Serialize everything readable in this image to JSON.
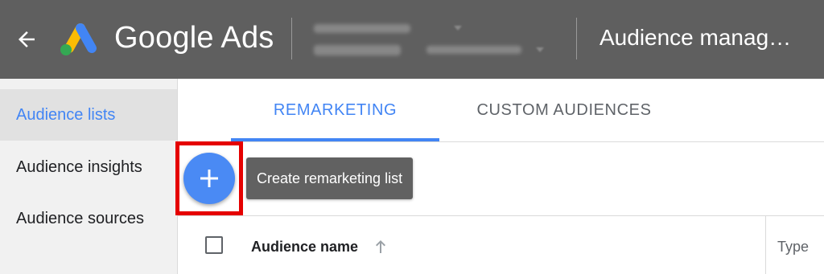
{
  "header": {
    "brand": "Google Ads",
    "page_title": "Audience manag…",
    "background_color": "#5f5f5f",
    "back_icon": "arrow-left-icon",
    "logo_icon": "google-ads-logo-icon"
  },
  "sidebar": {
    "items": [
      {
        "label": "Audience lists",
        "active": true
      },
      {
        "label": "Audience insights",
        "active": false
      },
      {
        "label": "Audience sources",
        "active": false
      }
    ]
  },
  "tabs": [
    {
      "label": "REMARKETING",
      "active": true
    },
    {
      "label": "CUSTOM AUDIENCES",
      "active": false
    }
  ],
  "fab": {
    "icon": "plus-icon",
    "tooltip": "Create remarketing list",
    "highlight_color": "#e50000",
    "color": "#4a8af4"
  },
  "table": {
    "columns": [
      {
        "label": "Audience name",
        "sort_icon": "arrow-up-icon"
      },
      {
        "label": "Type"
      }
    ]
  },
  "accent_color": "#4285f4"
}
